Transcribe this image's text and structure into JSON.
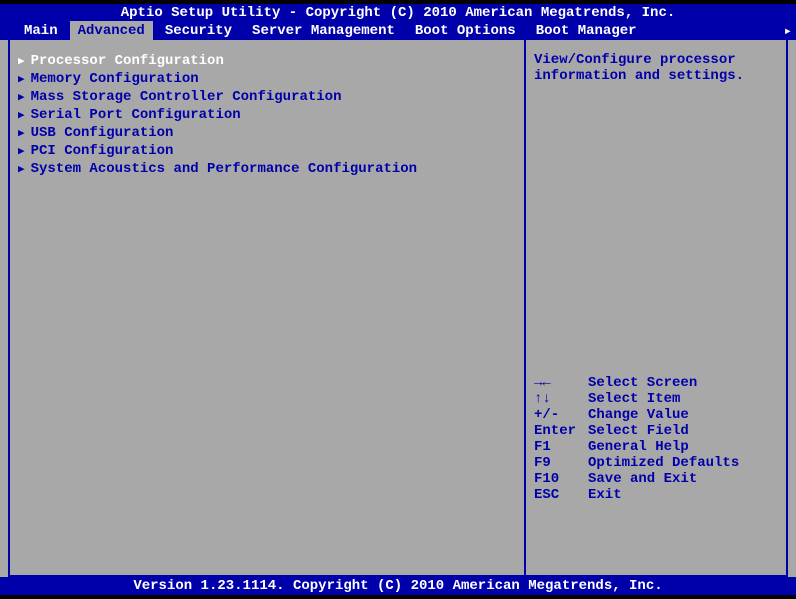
{
  "header": {
    "title": "Aptio Setup Utility - Copyright (C) 2010 American Megatrends, Inc."
  },
  "tabs": [
    {
      "label": "Main"
    },
    {
      "label": "Advanced"
    },
    {
      "label": "Security"
    },
    {
      "label": "Server Management"
    },
    {
      "label": "Boot Options"
    },
    {
      "label": "Boot Manager"
    }
  ],
  "menu_entries": [
    {
      "label": "Processor Configuration"
    },
    {
      "label": "Memory Configuration"
    },
    {
      "label": "Mass Storage Controller Configuration"
    },
    {
      "label": "Serial Port Configuration"
    },
    {
      "label": "USB Configuration"
    },
    {
      "label": "PCI Configuration"
    },
    {
      "label": "System Acoustics and Performance Configuration"
    }
  ],
  "help": {
    "line1": "View/Configure processor",
    "line2": "information and settings."
  },
  "keys": [
    {
      "key": "→←",
      "desc": "Select Screen"
    },
    {
      "key": "↑↓",
      "desc": "Select Item"
    },
    {
      "key": "+/-",
      "desc": "Change Value"
    },
    {
      "key": "Enter",
      "desc": "Select Field"
    },
    {
      "key": "F1",
      "desc": "General Help"
    },
    {
      "key": "F9",
      "desc": "Optimized Defaults"
    },
    {
      "key": "F10",
      "desc": "Save and Exit"
    },
    {
      "key": "ESC",
      "desc": "Exit"
    }
  ],
  "footer": {
    "text": "Version 1.23.1114. Copyright (C) 2010 American Megatrends, Inc."
  },
  "arrow_right": "▸"
}
